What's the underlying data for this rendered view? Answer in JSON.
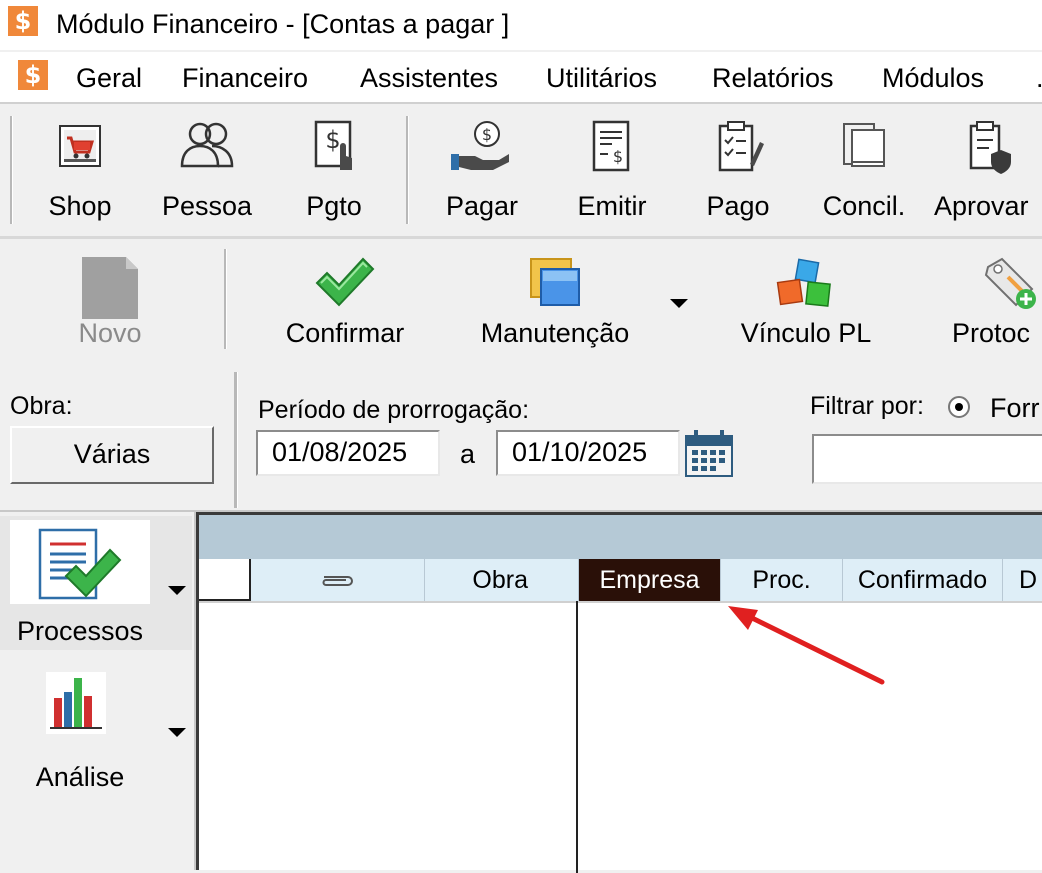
{
  "window": {
    "title": "Módulo Financeiro - [Contas a pagar ]",
    "app_icon": "$"
  },
  "menu": [
    "Geral",
    "Financeiro",
    "Assistentes",
    "Utilitários",
    "Relatórios",
    "Módulos",
    "."
  ],
  "toolbar": {
    "buttons": [
      {
        "label": "Shop",
        "icon": "shop-cart-icon"
      },
      {
        "label": "Pessoa",
        "icon": "people-icon"
      },
      {
        "label": "Pgto",
        "icon": "payment-touch-icon"
      },
      {
        "label": "Pagar",
        "icon": "hand-money-icon"
      },
      {
        "label": "Emitir",
        "icon": "invoice-icon"
      },
      {
        "label": "Pago",
        "icon": "clipboard-check-icon"
      },
      {
        "label": "Concil.",
        "icon": "reconcile-icon"
      },
      {
        "label": "Aprovar",
        "icon": "shield-clipboard-icon"
      }
    ]
  },
  "toolbar2": {
    "buttons": [
      {
        "label": "Novo",
        "icon": "new-document-icon",
        "disabled": true
      },
      {
        "label": "Confirmar",
        "icon": "green-check-icon"
      },
      {
        "label": "Manutenção",
        "icon": "maintenance-windows-icon"
      },
      {
        "label": "Vínculo PL",
        "icon": "cubes-icon"
      },
      {
        "label": "Protoc",
        "icon": "tag-add-icon"
      }
    ]
  },
  "filters": {
    "obra_label": "Obra:",
    "obra_button": "Várias",
    "period_label": "Período de prorrogação:",
    "date_from": "01/08/2025",
    "separator": "a",
    "date_to": "01/10/2025",
    "filter_label": "Filtrar por:",
    "filter_option": "Forr",
    "filter_value": ""
  },
  "leftnav": [
    {
      "label": "Processos",
      "icon": "processes-icon"
    },
    {
      "label": "Análise",
      "icon": "bar-chart-icon"
    }
  ],
  "grid": {
    "columns": [
      "",
      "",
      "Obra",
      "Empresa",
      "Proc.",
      "Confirmado",
      "D"
    ],
    "active_column": "Empresa"
  },
  "colors": {
    "accent_orange": "#f0883a",
    "header_active": "#2a1008",
    "arrow": "#e02020"
  }
}
